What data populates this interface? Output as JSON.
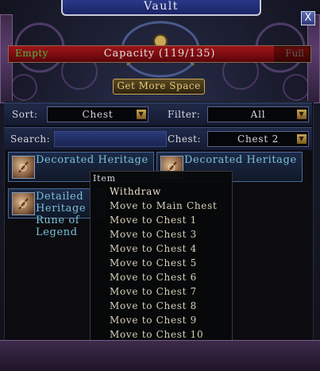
{
  "window": {
    "title": "Vault",
    "close_label": "X"
  },
  "capacity": {
    "empty_label": "Empty",
    "text": "Capacity (119/135)",
    "full_label": "Full",
    "fill_fraction": 0.88
  },
  "more_space_label": "Get More Space",
  "filters": {
    "sort_label": "Sort:",
    "sort_value": "Chest",
    "filter_label": "Filter:",
    "filter_value": "All",
    "search_label": "Search:",
    "search_value": "",
    "chest_label": "Chest:",
    "chest_value": "Chest 2"
  },
  "items": [
    {
      "name": "Decorated Heritage Rune of..."
    },
    {
      "name": "Decorated Heritage Rune of..."
    },
    {
      "name": "Detailed Heritage Rune of Legend"
    }
  ],
  "context_menu": {
    "header": "Item",
    "items": [
      "Withdraw",
      "Move to Main Chest",
      "Move to Chest 1",
      "Move to Chest 3",
      "Move to Chest 4",
      "Move to Chest 5",
      "Move to Chest 6",
      "Move to Chest 7",
      "Move to Chest 8",
      "Move to Chest 9",
      "Move to Chest 10"
    ]
  },
  "colors": {
    "item_name": "#7ac0d8",
    "empty_label": "#4fb84a",
    "capacity_bar": "#a0141a",
    "button_text": "#e8c878"
  },
  "icons": {
    "close": "close-icon",
    "dropdown": "chevron-down-icon",
    "item": "rune-icon"
  }
}
